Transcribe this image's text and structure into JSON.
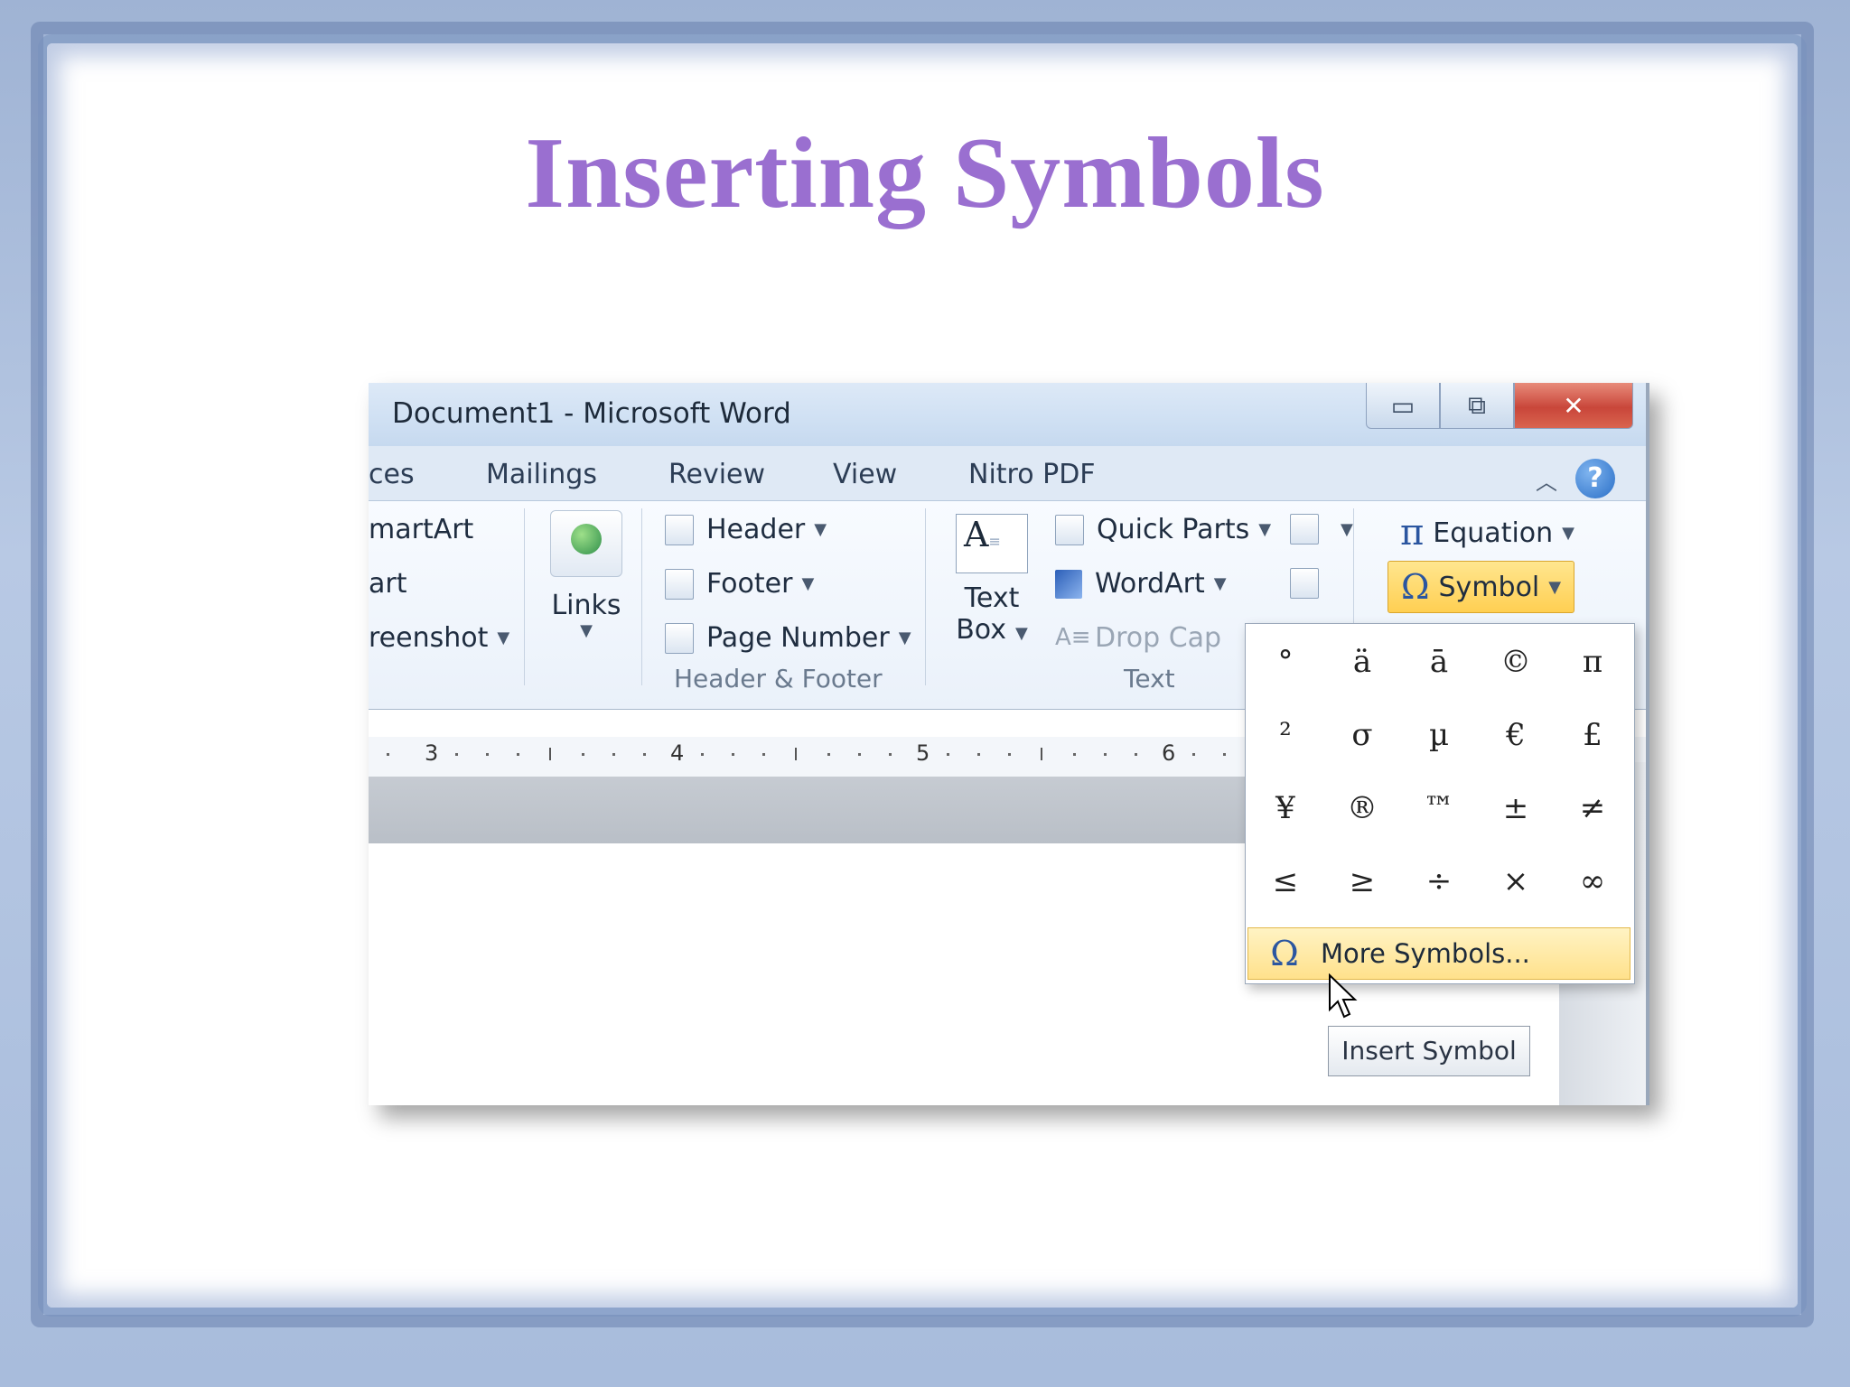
{
  "slide": {
    "title": "Inserting Symbols"
  },
  "window": {
    "title": "Document1  -  Microsoft Word",
    "controls": {
      "minimize": "▭",
      "maximize": "⧉",
      "close": "✕"
    }
  },
  "tabs": [
    "ces",
    "Mailings",
    "Review",
    "View",
    "Nitro PDF"
  ],
  "ribbon": {
    "illustrations_partial": [
      "martArt",
      "art",
      "reenshot"
    ],
    "links_label": "Links",
    "header_footer": {
      "items": [
        "Header",
        "Footer",
        "Page Number"
      ],
      "group_label": "Header & Footer"
    },
    "text": {
      "text_box_line1": "Text",
      "text_box_line2": "Box",
      "items": [
        "Quick Parts",
        "WordArt",
        "Drop Cap"
      ],
      "group_label": "Text"
    },
    "symbols": {
      "equation": "Equation",
      "symbol": "Symbol"
    }
  },
  "ruler": {
    "numbers": [
      "3",
      "4",
      "5",
      "6"
    ]
  },
  "symbol_menu": {
    "symbols": [
      "°",
      "ä",
      "ā",
      "©",
      "π",
      "²",
      "σ",
      "µ",
      "€",
      "£",
      "¥",
      "®",
      "™",
      "±",
      "≠",
      "≤",
      "≥",
      "÷",
      "×",
      "∞"
    ],
    "more_label": "More Symbols...",
    "omega": "Ω"
  },
  "tooltip": "Insert Symbol",
  "colors": {
    "title": "#9a6fd0",
    "highlight": "#ffe18c"
  }
}
